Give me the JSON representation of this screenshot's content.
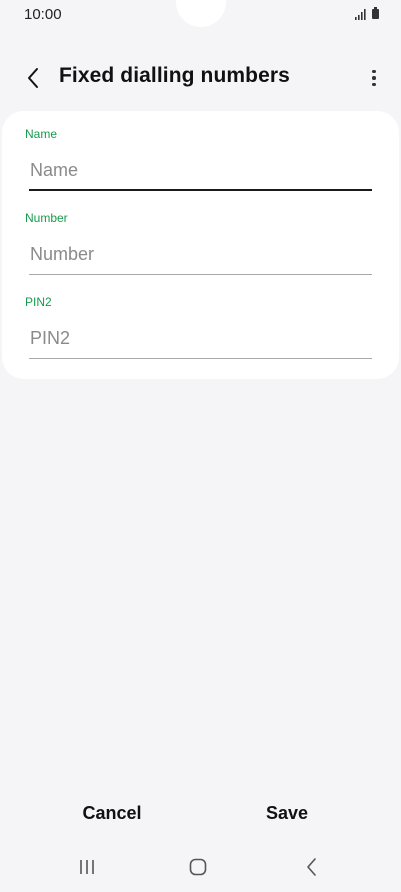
{
  "status_bar": {
    "time": "10:00",
    "icons": [
      "signal-icon",
      "battery-icon"
    ]
  },
  "header": {
    "back_icon": "chevron-left-icon",
    "title": "Fixed dialling numbers",
    "more_icon": "more-vertical-icon"
  },
  "form": {
    "fields": [
      {
        "label": "Name",
        "placeholder": "Name",
        "value": "",
        "focused": true
      },
      {
        "label": "Number",
        "placeholder": "Number",
        "value": "",
        "focused": false
      },
      {
        "label": "PIN2",
        "placeholder": "PIN2",
        "value": "",
        "focused": false
      }
    ]
  },
  "actions": {
    "cancel_label": "Cancel",
    "save_label": "Save"
  },
  "nav_bar": {
    "icons": [
      "recents-icon",
      "home-icon",
      "back-icon"
    ]
  },
  "colors": {
    "accent_label": "#179b4d",
    "background": "#f5f5f7",
    "card": "#ffffff"
  }
}
